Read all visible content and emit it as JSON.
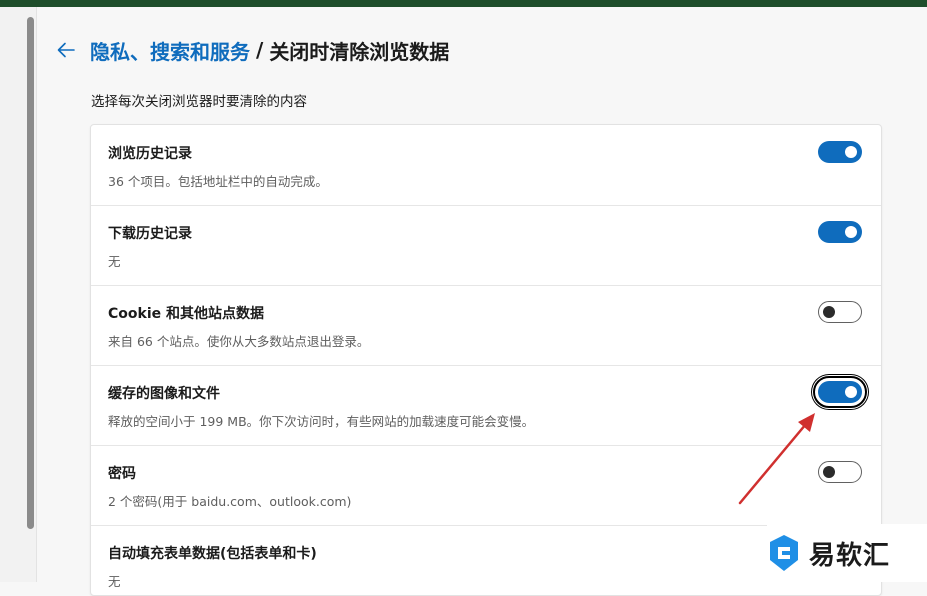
{
  "breadcrumb": {
    "parent": "隐私、搜索和服务",
    "separator": "/",
    "current": "关闭时清除浏览数据"
  },
  "subtitle": "选择每次关闭浏览器时要清除的内容",
  "items": [
    {
      "title": "浏览历史记录",
      "desc": "36 个项目。包括地址栏中的自动完成。",
      "enabled": true
    },
    {
      "title": "下载历史记录",
      "desc": "无",
      "enabled": true
    },
    {
      "title": "Cookie 和其他站点数据",
      "desc": "来自 66 个站点。使你从大多数站点退出登录。",
      "enabled": false
    },
    {
      "title": "缓存的图像和文件",
      "desc": "释放的空间小于 199 MB。你下次访问时，有些网站的加载速度可能会变慢。",
      "enabled": true,
      "focused": true
    },
    {
      "title": "密码",
      "desc": "2 个密码(用于 baidu.com、outlook.com)",
      "enabled": false
    },
    {
      "title": "自动填充表单数据(包括表单和卡)",
      "desc": "无",
      "enabled": false
    }
  ],
  "watermark": {
    "text": "易软汇"
  },
  "colors": {
    "accent": "#0f6cbd",
    "annotation_arrow": "#d0302f",
    "top_bar": "#1f4e2b"
  }
}
